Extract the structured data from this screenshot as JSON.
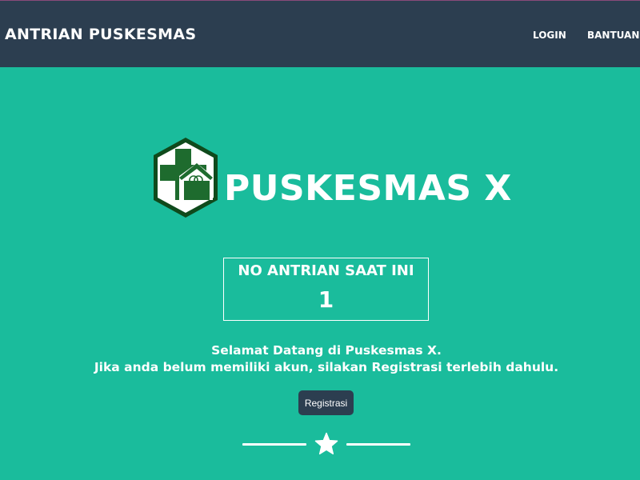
{
  "navbar": {
    "brand": "ANTRIAN PUSKESMAS",
    "links": [
      "LOGIN",
      "BANTUAN"
    ]
  },
  "hero": {
    "title": "PUSKESMAS X",
    "logo_icon": "puskesmas-logo-icon"
  },
  "queue": {
    "label": "NO ANTRIAN SAAT INI",
    "number": "1"
  },
  "welcome": {
    "line1": "Selamat Datang di Puskesmas X.",
    "line2": "Jika anda belum memiliki akun, silakan Registrasi terlebih dahulu."
  },
  "register_button": "Registrasi",
  "divider": {
    "icon": "star-icon"
  },
  "colors": {
    "navbar_bg": "#2c3e50",
    "page_bg": "#1abc9c",
    "text": "#ffffff",
    "logo_green": "#1e6b2e",
    "logo_border": "#0f4a1c"
  }
}
